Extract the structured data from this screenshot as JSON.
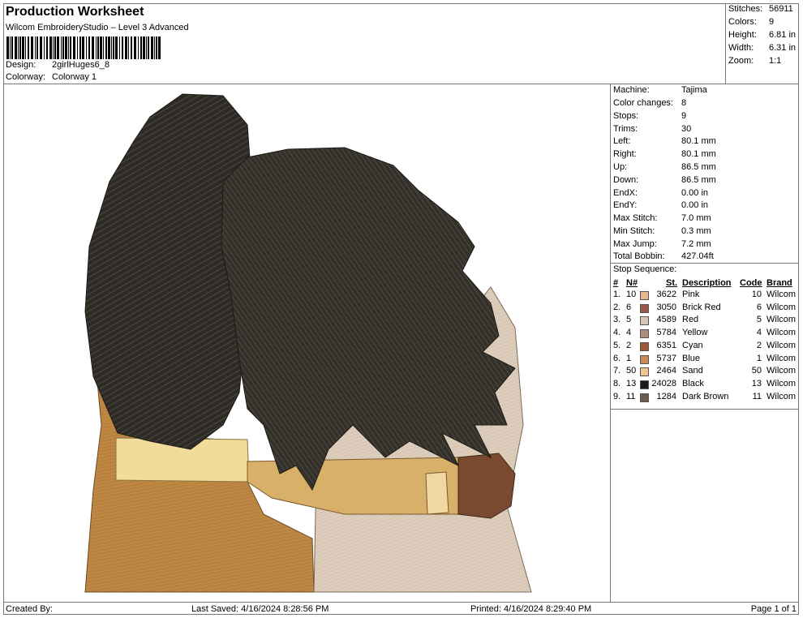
{
  "header": {
    "title": "Production Worksheet",
    "subtitle": "Wilcom EmbroideryStudio – Level 3 Advanced",
    "design_label": "Design:",
    "design_value": "2girlHuges6_8",
    "colorway_label": "Colorway:",
    "colorway_value": "Colorway 1"
  },
  "stats": [
    {
      "label": "Stitches:",
      "value": "56911"
    },
    {
      "label": "Colors:",
      "value": "9"
    },
    {
      "label": "Height:",
      "value": "6.81 in"
    },
    {
      "label": "Width:",
      "value": "6.31 in"
    },
    {
      "label": "Zoom:",
      "value": "1:1"
    }
  ],
  "machine_info": [
    {
      "label": "Machine:",
      "value": "Tajima"
    },
    {
      "label": "Color changes:",
      "value": "8"
    },
    {
      "label": "Stops:",
      "value": "9"
    },
    {
      "label": "Trims:",
      "value": "30"
    },
    {
      "label": "Left:",
      "value": "80.1 mm"
    },
    {
      "label": "Right:",
      "value": "80.1 mm"
    },
    {
      "label": "Up:",
      "value": "86.5 mm"
    },
    {
      "label": "Down:",
      "value": "86.5 mm"
    },
    {
      "label": "EndX:",
      "value": "0.00 in"
    },
    {
      "label": "EndY:",
      "value": "0.00 in"
    },
    {
      "label": "Max Stitch:",
      "value": "7.0 mm"
    },
    {
      "label": "Min Stitch:",
      "value": "0.3 mm"
    },
    {
      "label": "Max Jump:",
      "value": "7.2 mm"
    },
    {
      "label": "Total Bobbin:",
      "value": "427.04ft"
    }
  ],
  "stop_sequence": {
    "title": "Stop Sequence:",
    "headers": {
      "num": "#",
      "n": "N#",
      "st": "St.",
      "desc": "Description",
      "code": "Code",
      "brand": "Brand"
    },
    "rows": [
      {
        "num": "1.",
        "n": "10",
        "color": "#e6b98c",
        "st": "3622",
        "desc": "Pink",
        "code": "10",
        "brand": "Wilcom"
      },
      {
        "num": "2.",
        "n": "6",
        "color": "#9a5a45",
        "st": "3050",
        "desc": "Brick Red",
        "code": "6",
        "brand": "Wilcom"
      },
      {
        "num": "3.",
        "n": "5",
        "color": "#d9c4b8",
        "st": "4589",
        "desc": "Red",
        "code": "5",
        "brand": "Wilcom"
      },
      {
        "num": "4.",
        "n": "4",
        "color": "#b08a7a",
        "st": "5784",
        "desc": "Yellow",
        "code": "4",
        "brand": "Wilcom"
      },
      {
        "num": "5.",
        "n": "2",
        "color": "#a0583a",
        "st": "6351",
        "desc": "Cyan",
        "code": "2",
        "brand": "Wilcom"
      },
      {
        "num": "6.",
        "n": "1",
        "color": "#c98a55",
        "st": "5737",
        "desc": "Blue",
        "code": "1",
        "brand": "Wilcom"
      },
      {
        "num": "7.",
        "n": "50",
        "color": "#f0c48e",
        "st": "2464",
        "desc": "Sand",
        "code": "50",
        "brand": "Wilcom"
      },
      {
        "num": "8.",
        "n": "13",
        "color": "#1e1a18",
        "st": "24028",
        "desc": "Black",
        "code": "13",
        "brand": "Wilcom"
      },
      {
        "num": "9.",
        "n": "11",
        "color": "#6b5a50",
        "st": "1284",
        "desc": "Dark Brown",
        "code": "11",
        "brand": "Wilcom"
      }
    ]
  },
  "footer": {
    "created_by": "Created By:",
    "last_saved": "Last Saved: 4/16/2024 8:28:56 PM",
    "printed": "Printed: 4/16/2024 8:29:40 PM",
    "page": "Page 1 of 1"
  }
}
